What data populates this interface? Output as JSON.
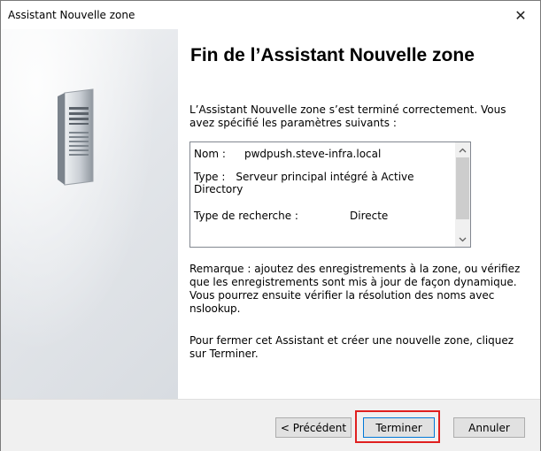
{
  "window": {
    "title": "Assistant Nouvelle zone",
    "close_glyph": "✕"
  },
  "main": {
    "heading": "Fin de l’Assistant Nouvelle zone",
    "intro": "L’Assistant Nouvelle zone s’est terminé correctement. Vous avez spécifié les paramètres suivants :",
    "summary": {
      "name_label": "Nom :",
      "name_value": "pwdpush.steve-infra.local",
      "type_label": "Type :",
      "type_value": "Serveur principal intégré à Active Directory",
      "lookup_label": "Type de recherche :",
      "lookup_value": "Directe"
    },
    "remark": "Remarque : ajoutez des enregistrements à la zone, ou vérifiez que les enregistrements sont mis à jour de façon dynamique. Vous pourrez ensuite vérifier la résolution des noms avec nslookup.",
    "closing": "Pour fermer cet Assistant et créer une nouvelle zone, cliquez sur Terminer."
  },
  "footer": {
    "back_label": "< Précédent",
    "finish_label": "Terminer",
    "cancel_label": "Annuler"
  },
  "colors": {
    "highlight": "#e02020",
    "default_button_border": "#0078d7"
  },
  "icons": {
    "server": "server-tower-icon",
    "close": "close-icon"
  }
}
